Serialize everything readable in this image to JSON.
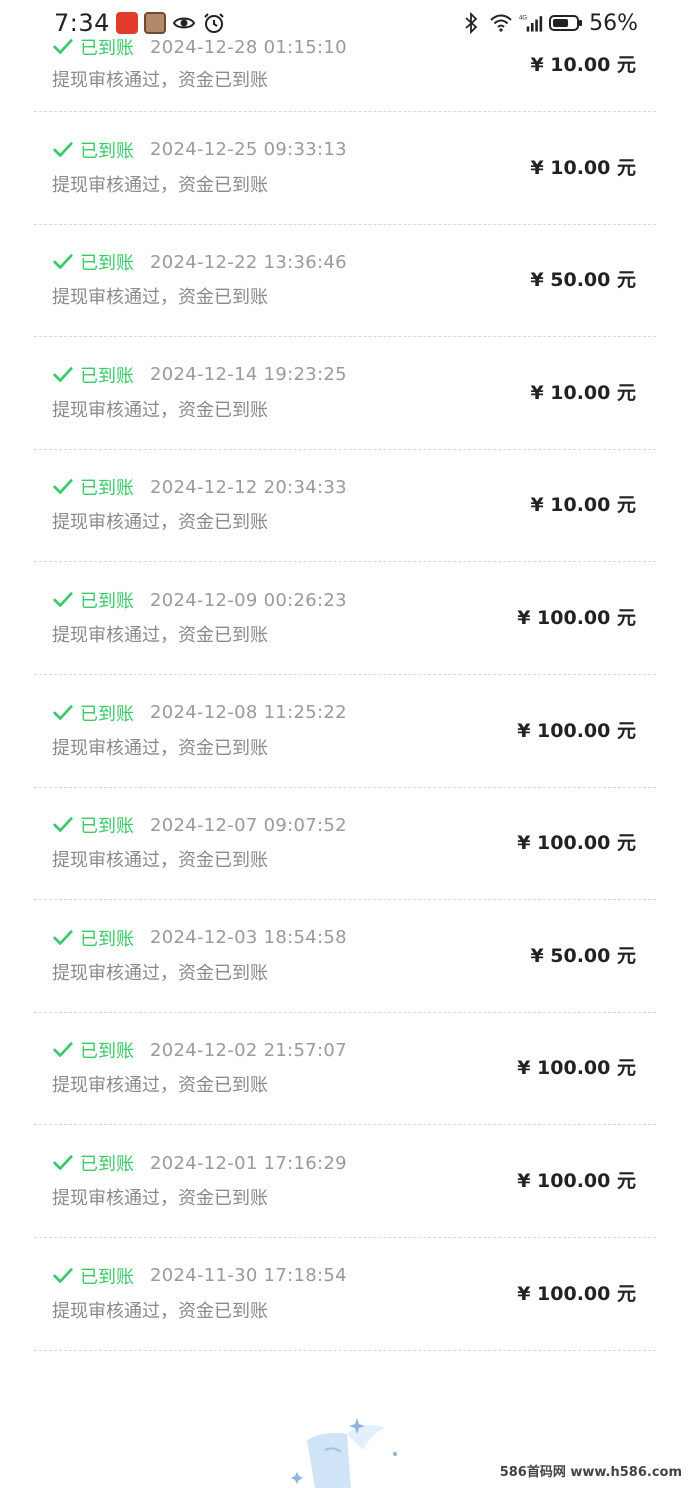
{
  "status_bar": {
    "time": "7:34",
    "battery": "56%",
    "network": "4G",
    "icons": [
      "app-icon-red",
      "app-icon-avatar",
      "eye-icon",
      "alarm-icon",
      "bluetooth-icon",
      "wifi-icon",
      "signal-icon",
      "battery-icon"
    ]
  },
  "records": [
    {
      "status": "已到账",
      "datetime": "2024-12-28 01:15:10",
      "desc": "提现审核通过，资金已到账",
      "amount": "¥ 10.00 元"
    },
    {
      "status": "已到账",
      "datetime": "2024-12-25 09:33:13",
      "desc": "提现审核通过，资金已到账",
      "amount": "¥ 10.00 元"
    },
    {
      "status": "已到账",
      "datetime": "2024-12-22 13:36:46",
      "desc": "提现审核通过，资金已到账",
      "amount": "¥ 50.00 元"
    },
    {
      "status": "已到账",
      "datetime": "2024-12-14 19:23:25",
      "desc": "提现审核通过，资金已到账",
      "amount": "¥ 10.00 元"
    },
    {
      "status": "已到账",
      "datetime": "2024-12-12 20:34:33",
      "desc": "提现审核通过，资金已到账",
      "amount": "¥ 10.00 元"
    },
    {
      "status": "已到账",
      "datetime": "2024-12-09 00:26:23",
      "desc": "提现审核通过，资金已到账",
      "amount": "¥ 100.00 元"
    },
    {
      "status": "已到账",
      "datetime": "2024-12-08 11:25:22",
      "desc": "提现审核通过，资金已到账",
      "amount": "¥ 100.00 元"
    },
    {
      "status": "已到账",
      "datetime": "2024-12-07 09:07:52",
      "desc": "提现审核通过，资金已到账",
      "amount": "¥ 100.00 元"
    },
    {
      "status": "已到账",
      "datetime": "2024-12-03 18:54:58",
      "desc": "提现审核通过，资金已到账",
      "amount": "¥ 50.00 元"
    },
    {
      "status": "已到账",
      "datetime": "2024-12-02 21:57:07",
      "desc": "提现审核通过，资金已到账",
      "amount": "¥ 100.00 元"
    },
    {
      "status": "已到账",
      "datetime": "2024-12-01 17:16:29",
      "desc": "提现审核通过，资金已到账",
      "amount": "¥ 100.00 元"
    },
    {
      "status": "已到账",
      "datetime": "2024-11-30 17:18:54",
      "desc": "提现审核通过，资金已到账",
      "amount": "¥ 100.00 元"
    }
  ],
  "colors": {
    "success": "#3cc86b",
    "muted": "#9a9a9a",
    "divider": "#d8d8d8"
  },
  "watermark": "586首码网 www.h586.com"
}
